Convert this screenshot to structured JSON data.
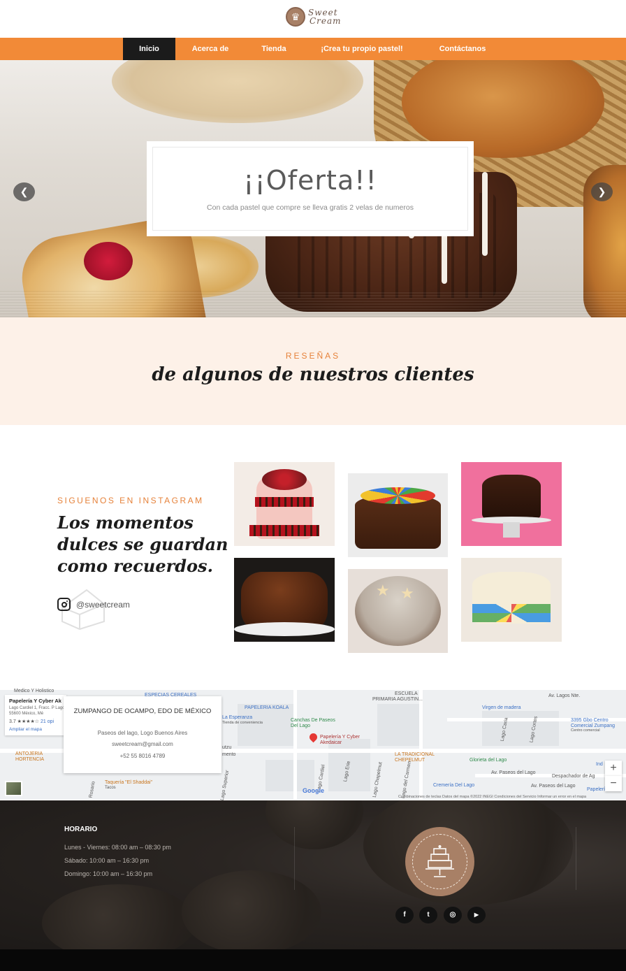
{
  "header": {
    "logo_text_line1": "Sweet",
    "logo_text_line2": "Cream"
  },
  "nav": {
    "items": [
      {
        "label": "Inicio",
        "active": true
      },
      {
        "label": "Acerca de",
        "active": false
      },
      {
        "label": "Tienda",
        "active": false
      },
      {
        "label": "¡Crea tu propio pastel!",
        "active": false
      },
      {
        "label": "Contáctanos",
        "active": false
      }
    ],
    "accent_color": "#f28a37"
  },
  "hero": {
    "title": "¡¡Oferta!!",
    "subtitle": "Con cada pastel que compre se lleva gratis 2 velas de numeros",
    "prev_icon": "chevron-left-icon",
    "next_icon": "chevron-right-icon"
  },
  "reviews": {
    "kicker": "RESEÑAS",
    "title": "de algunos de nuestros clientes"
  },
  "instagram": {
    "kicker": "SIGUENOS EN INSTAGRAM",
    "title": "Los momentos dulces se guardan como recuerdos.",
    "handle": "@sweetcream",
    "photos": [
      "strawberry-tiered-cake",
      "chocolate-candy-cake",
      "chocolate-cake-pink-background",
      "chocolate-fudge-cake-slice",
      "star-decorated-cake",
      "vanilla-sprinkle-cake"
    ]
  },
  "map": {
    "card_title": "ZUMPANGO DE OCAMPO, EDO DE MÉXICO",
    "card_address": "Paseos del lago, Logo Buenos Aires",
    "card_email": "sweetcream@gmail.com",
    "card_phone": "+52 55 8016 4789",
    "place_name": "Papelería Y Cyber Ak",
    "place_address": "Lago Cardiel 1, Fracc. P Lago, 55600 México, Mé",
    "place_rating": "3.7 ★★★★☆",
    "place_reviews": "21 opi",
    "place_link": "Ampliar el mapa",
    "labels": {
      "medico": "Medico Y Holistico",
      "especias": "ESPECIAS CEREALES",
      "papeleria_koala": "PAPELERIA KOALA",
      "esperanza": "La Esperanza",
      "esperanza_sub": "Tienda de conveniencia",
      "escuela": "ESCUELA",
      "primaria": "PRIMARIA AGUSTIN...",
      "lagos_nte": "Av. Lagos Nte.",
      "virgen": "Virgen de madera",
      "canchas": "Canchas De Paseos Del Lago",
      "papeleria_cyber": "Papelería Y Cyber Akedaicar",
      "lago_caria": "Lago Caria",
      "lago_cortes": "Lago Cortes",
      "gbo_centro": "3395 Gbo Centro Comercial Zumpang",
      "gbo_sub": "Centro comercial",
      "antojeria": "ANTOJERIA HORTENCIA",
      "tradicional": "LA TRADICIONAL CHEPELMUT",
      "glorieta": "Glorieta del Lago",
      "paseos": "Av. Paseos del Lago",
      "despachador": "Despachador de Ag",
      "cremeria": "Cremería Del Lago",
      "paseos2": "Av. Paseos del Lago",
      "papeleria_r": "Papelería",
      "taqueria": "Taquería \"El Shaddai\"",
      "tacos": "Tacos",
      "lago_cardiel": "Lago Cardiel",
      "lago_erie": "Lago Erie",
      "lago_chapelmut": "Lago Chapelmut",
      "lago_carmen": "Lago del Carmen",
      "rosario": "Rosario",
      "superior": "Lago Superior",
      "tutzu": "utzu",
      "mento": "mento",
      "ind": "Ind"
    },
    "google": "Google",
    "footer": "Combinaciones de teclas   Datos del mapa ©2022 INEGI   Condiciones del Servicio   Informar un error en el mapa",
    "zoom_in": "+",
    "zoom_out": "−"
  },
  "footer": {
    "heading": "HORARIO",
    "hours": [
      "Lunes - Viernes: 08:00 am – 08:30 pm",
      "Sábado: 10:00 am – 16:30 pm",
      "Domingo: 10:00 am – 16:30 pm"
    ],
    "social": [
      {
        "icon": "facebook-icon",
        "glyph": "f"
      },
      {
        "icon": "twitter-icon",
        "glyph": "t"
      },
      {
        "icon": "instagram-icon",
        "glyph": "◎"
      },
      {
        "icon": "youtube-icon",
        "glyph": "▶"
      }
    ],
    "brand_color": "#a88066"
  }
}
